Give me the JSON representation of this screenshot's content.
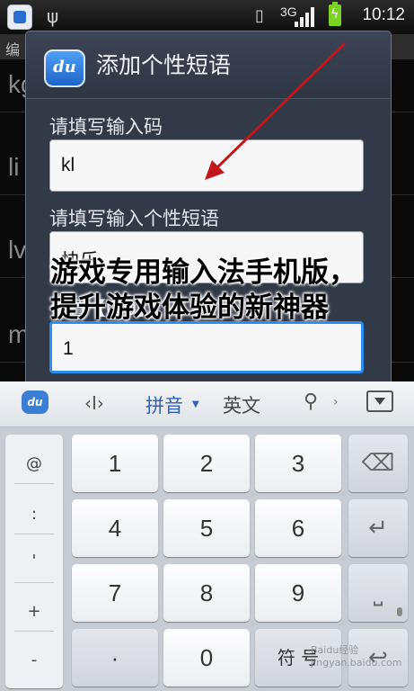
{
  "status_bar": {
    "network_label": "3G",
    "time": "10:12",
    "battery_color": "#7ad321"
  },
  "background": {
    "header_text": "编",
    "rows": [
      "kg",
      "li",
      "lv",
      "m"
    ]
  },
  "dialog": {
    "logo": "du",
    "title": "添加个性短语",
    "code_label": "请填写输入码",
    "code_value": "kl",
    "phrase_label": "请填写输入个性短语",
    "phrase_value": "快乐",
    "position_label": "位置【0-9】",
    "position_value": "1",
    "accent_color": "#2a8df1"
  },
  "overlay_title": "游戏专用输入法手机版，提升游戏体验的新神器",
  "keyboard": {
    "toolbar": {
      "logo": "du",
      "cursor_icon": "‹I›",
      "pinyin": "拼音",
      "english": "英文"
    },
    "symbols": [
      "@",
      ":",
      "'",
      "+",
      "-"
    ],
    "keys": [
      "1",
      "2",
      "3",
      "4",
      "5",
      "6",
      "7",
      "8",
      "9",
      "0"
    ],
    "bottom_key": "符 号"
  },
  "watermark": "Baidu经验 jingyan.baidu.com"
}
